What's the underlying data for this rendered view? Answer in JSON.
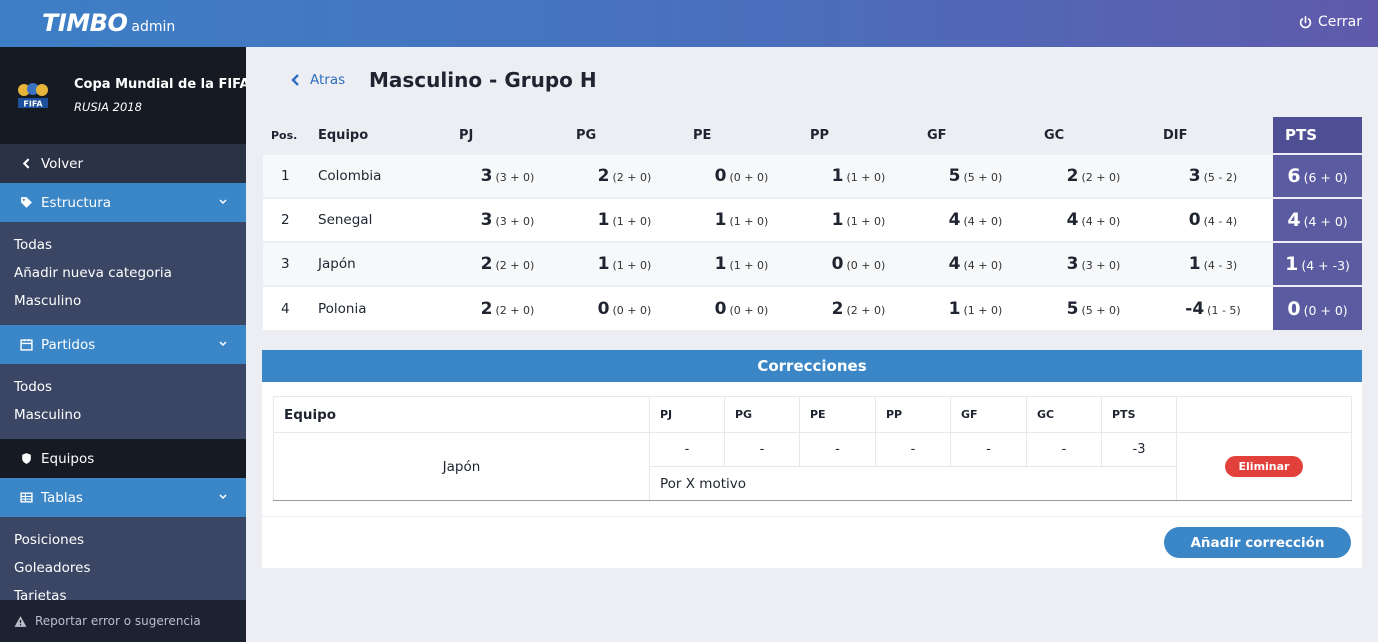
{
  "topbar": {
    "logo_main": "TIMBO",
    "logo_sub": "admin",
    "logout_label": "Cerrar"
  },
  "sidebar": {
    "tournament_name": "Copa Mundial de la FIFA",
    "tournament_sub": "RUSIA 2018",
    "back_label": "Volver",
    "sections": [
      {
        "label": "Estructura",
        "icon": "tag-icon",
        "items": [
          "Todas",
          "Añadir nueva categoria",
          "Masculino"
        ]
      },
      {
        "label": "Partidos",
        "icon": "calendar-icon",
        "items": [
          "Todos",
          "Masculino"
        ]
      },
      {
        "label": "Equipos",
        "icon": "shield-icon",
        "items": []
      },
      {
        "label": "Tablas",
        "icon": "table-icon",
        "items": [
          "Posiciones",
          "Goleadores",
          "Tarjetas"
        ]
      }
    ],
    "report_label": "Reportar error o sugerencia"
  },
  "page": {
    "back_label": "Atras",
    "title": "Masculino - Grupo H"
  },
  "standings": {
    "headers": [
      "Pos.",
      "Equipo",
      "PJ",
      "PG",
      "PE",
      "PP",
      "GF",
      "GC",
      "DIF",
      "PTS"
    ],
    "rows": [
      {
        "pos": "1",
        "team": "Colombia",
        "pj": [
          "3",
          "(3 + 0)"
        ],
        "pg": [
          "2",
          "(2 + 0)"
        ],
        "pe": [
          "0",
          "(0 + 0)"
        ],
        "pp": [
          "1",
          "(1 + 0)"
        ],
        "gf": [
          "5",
          "(5 + 0)"
        ],
        "gc": [
          "2",
          "(2 + 0)"
        ],
        "dif": [
          "3",
          "(5 - 2)"
        ],
        "pts": [
          "6",
          "(6 + 0)"
        ]
      },
      {
        "pos": "2",
        "team": "Senegal",
        "pj": [
          "3",
          "(3 + 0)"
        ],
        "pg": [
          "1",
          "(1 + 0)"
        ],
        "pe": [
          "1",
          "(1 + 0)"
        ],
        "pp": [
          "1",
          "(1 + 0)"
        ],
        "gf": [
          "4",
          "(4 + 0)"
        ],
        "gc": [
          "4",
          "(4 + 0)"
        ],
        "dif": [
          "0",
          "(4 - 4)"
        ],
        "pts": [
          "4",
          "(4 + 0)"
        ]
      },
      {
        "pos": "3",
        "team": "Japón",
        "pj": [
          "2",
          "(2 + 0)"
        ],
        "pg": [
          "1",
          "(1 + 0)"
        ],
        "pe": [
          "1",
          "(1 + 0)"
        ],
        "pp": [
          "0",
          "(0 + 0)"
        ],
        "gf": [
          "4",
          "(4 + 0)"
        ],
        "gc": [
          "3",
          "(3 + 0)"
        ],
        "dif": [
          "1",
          "(4 - 3)"
        ],
        "pts": [
          "1",
          "(4 + -3)"
        ]
      },
      {
        "pos": "4",
        "team": "Polonia",
        "pj": [
          "2",
          "(2 + 0)"
        ],
        "pg": [
          "0",
          "(0 + 0)"
        ],
        "pe": [
          "0",
          "(0 + 0)"
        ],
        "pp": [
          "2",
          "(2 + 0)"
        ],
        "gf": [
          "1",
          "(1 + 0)"
        ],
        "gc": [
          "5",
          "(5 + 0)"
        ],
        "dif": [
          "-4",
          "(1 - 5)"
        ],
        "pts": [
          "0",
          "(0 + 0)"
        ]
      }
    ]
  },
  "corrections": {
    "title": "Correcciones",
    "headers": [
      "Equipo",
      "PJ",
      "PG",
      "PE",
      "PP",
      "GF",
      "GC",
      "PTS"
    ],
    "rows": [
      {
        "team": "Japón",
        "values": [
          "-",
          "-",
          "-",
          "-",
          "-",
          "-",
          "-3"
        ],
        "reason": "Por X motivo",
        "delete_label": "Eliminar"
      }
    ],
    "add_label": "Añadir corrección"
  },
  "colors": {
    "accent": "#3b86c7",
    "pts_column": "#5b5ba2",
    "danger": "#e2403a",
    "sidebar": "#3a4664"
  }
}
